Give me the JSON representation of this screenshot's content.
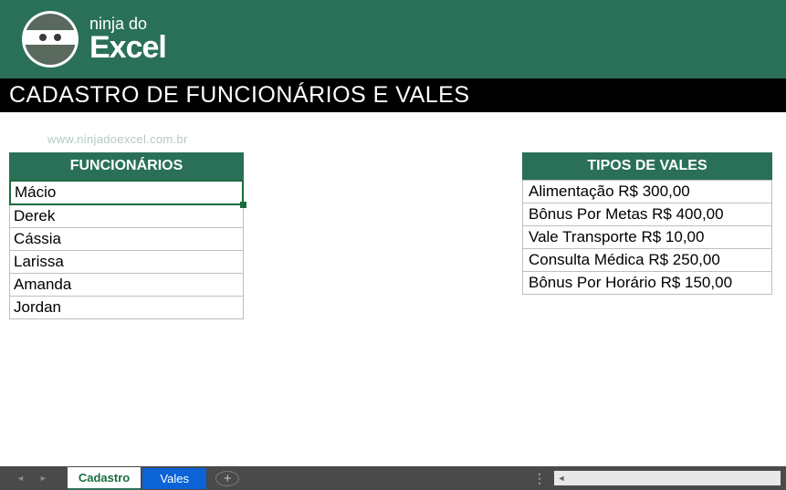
{
  "brand": {
    "top": "ninja do",
    "bottom": "Excel"
  },
  "title": "CADASTRO DE FUNCIONÁRIOS E VALES",
  "watermark": "www.ninjadoexcel.com.br",
  "funcionarios": {
    "header": "FUNCIONÁRIOS",
    "rows": [
      "Mácio",
      "Derek",
      "Cássia",
      "Larissa",
      "Amanda",
      "Jordan"
    ]
  },
  "vales": {
    "header": "TIPOS DE VALES",
    "rows": [
      "Alimentação R$ 300,00",
      "Bônus Por Metas R$ 400,00",
      "Vale Transporte R$ 10,00",
      "Consulta Médica R$ 250,00",
      "Bônus Por Horário R$ 150,00"
    ]
  },
  "tabs": {
    "items": [
      {
        "label": "Cadastro"
      },
      {
        "label": "Vales"
      }
    ]
  }
}
